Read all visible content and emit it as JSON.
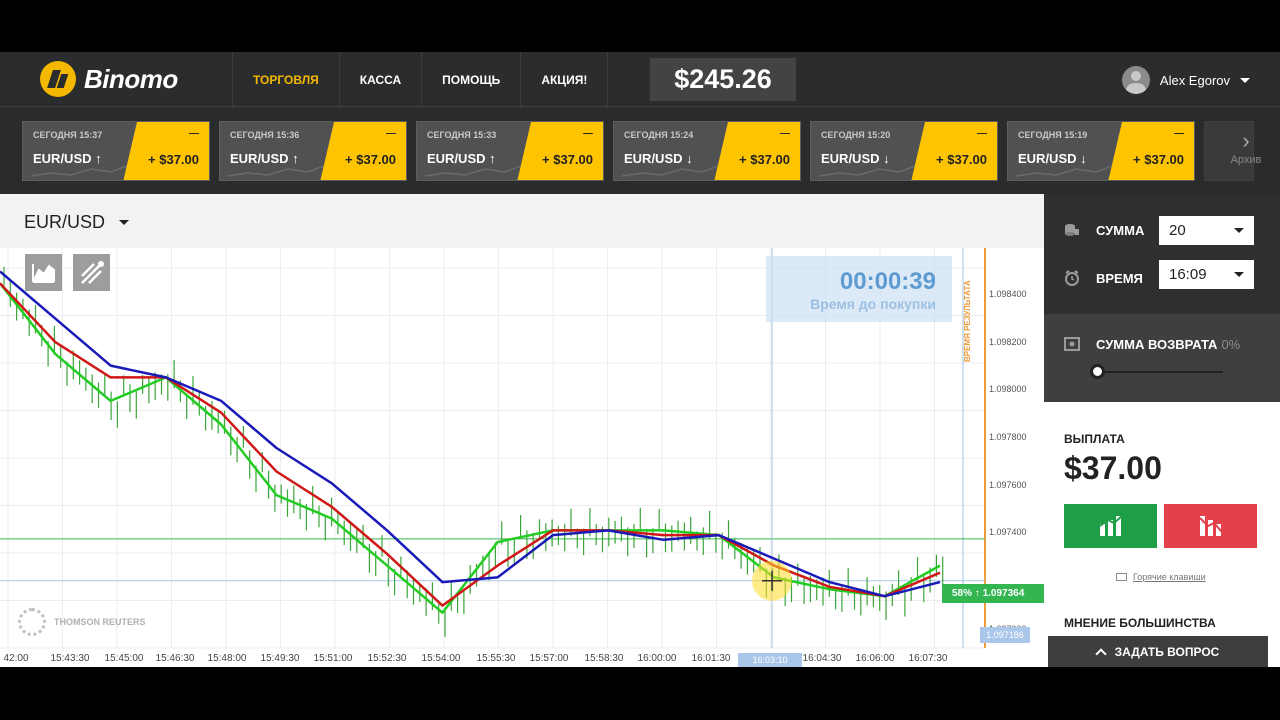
{
  "brand": {
    "name": "Binomo"
  },
  "nav": [
    {
      "label": "ТОРГОВЛЯ",
      "active": true
    },
    {
      "label": "КАССА"
    },
    {
      "label": "ПОМОЩЬ"
    },
    {
      "label": "АКЦИЯ!"
    }
  ],
  "balance": "$245.26",
  "user": {
    "name": "Alex Egorov"
  },
  "deals": [
    {
      "time": "СЕГОДНЯ 15:37",
      "pair": "EUR/USD",
      "direction": "↑",
      "dash": "—",
      "amount": "+ $37.00"
    },
    {
      "time": "СЕГОДНЯ 15:36",
      "pair": "EUR/USD",
      "direction": "↑",
      "dash": "—",
      "amount": "+ $37.00"
    },
    {
      "time": "СЕГОДНЯ 15:33",
      "pair": "EUR/USD",
      "direction": "↑",
      "dash": "—",
      "amount": "+ $37.00"
    },
    {
      "time": "СЕГОДНЯ 15:24",
      "pair": "EUR/USD",
      "direction": "↓",
      "dash": "—",
      "amount": "+ $37.00"
    },
    {
      "time": "СЕГОДНЯ 15:20",
      "pair": "EUR/USD",
      "direction": "↓",
      "dash": "—",
      "amount": "+ $37.00"
    },
    {
      "time": "СЕГОДНЯ 15:19",
      "pair": "EUR/USD",
      "direction": "↓",
      "dash": "—",
      "amount": "+ $37.00"
    }
  ],
  "archive_label": "Архив",
  "chart": {
    "pair": "EUR/USD",
    "timer": "00:00:39",
    "timer_label": "Время до покупки",
    "result_time_label": "ВРЕМЯ РЕЗУЛЬТАТА",
    "provider": "THOMSON REUTERS",
    "price_tag": "58% ↑ 1.097364",
    "cursor_price": "1.097186",
    "cursor_time": "16:03:10",
    "y_ticks": [
      "1.098400",
      "1.098200",
      "1.098000",
      "1.097800",
      "1.097600",
      "1.097400",
      "1.097000"
    ],
    "x_ticks": [
      "42:00",
      "15:43:30",
      "15:45:00",
      "15:46:30",
      "15:48:00",
      "15:49:30",
      "15:51:00",
      "15:52:30",
      "15:54:00",
      "15:55:30",
      "15:57:00",
      "15:58:30",
      "16:00:00",
      "16:01:30",
      "16:04:30",
      "16:06:00",
      "16:07:30"
    ],
    "colors": {
      "fast": "#22cc22",
      "mid": "#d01818",
      "slow": "#1a1ab8",
      "candle": "#3aa63a"
    }
  },
  "chart_data": {
    "type": "line",
    "x": [
      "15:42:00",
      "15:43:30",
      "15:45:00",
      "15:46:30",
      "15:48:00",
      "15:49:30",
      "15:51:00",
      "15:52:30",
      "15:54:00",
      "15:55:30",
      "15:57:00",
      "15:58:30",
      "16:00:00",
      "16:01:30",
      "16:03:00",
      "16:04:30",
      "16:06:00",
      "16:07:30"
    ],
    "series": [
      {
        "values": [
          1.09845,
          1.09815,
          1.09795,
          1.09805,
          1.09785,
          1.09755,
          1.09745,
          1.09725,
          1.09705,
          1.09735,
          1.0974,
          1.0974,
          1.0974,
          1.09738,
          1.0972,
          1.09715,
          1.09712,
          1.09725
        ]
      },
      {
        "values": [
          1.09845,
          1.0982,
          1.09805,
          1.09805,
          1.0979,
          1.09765,
          1.0975,
          1.0973,
          1.09708,
          1.09725,
          1.0974,
          1.0974,
          1.09738,
          1.09738,
          1.09725,
          1.09716,
          1.09712,
          1.09722
        ]
      },
      {
        "values": [
          1.0985,
          1.0983,
          1.0981,
          1.09805,
          1.09795,
          1.09775,
          1.0976,
          1.0974,
          1.09718,
          1.0972,
          1.09738,
          1.0974,
          1.09736,
          1.09738,
          1.09728,
          1.09718,
          1.09712,
          1.09718
        ]
      }
    ],
    "ylim": [
      1.0969,
      1.0986
    ],
    "grid": true
  },
  "panel": {
    "amount_label": "СУММА",
    "amount_value": "20",
    "time_label": "ВРЕМЯ",
    "time_value": "16:09",
    "refund_label": "СУММА ВОЗВРАТА",
    "refund_value": "0%",
    "payout_label": "ВЫПЛАТА",
    "payout_value": "$37.00",
    "hotkeys": "Горячие клавиши",
    "majority": "МНЕНИЕ БОЛЬШИНСТВА",
    "ask": "ЗАДАТЬ ВОПРОС"
  }
}
